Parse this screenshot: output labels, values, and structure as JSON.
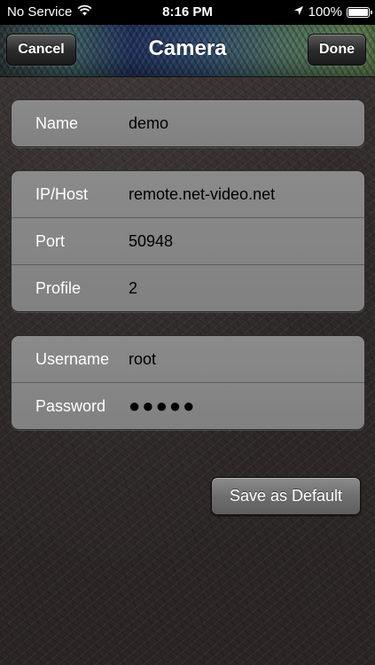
{
  "status_bar": {
    "carrier": "No Service",
    "time": "8:16 PM",
    "battery_percent": "100%",
    "battery_level": 1.0
  },
  "nav": {
    "title": "Camera",
    "cancel_label": "Cancel",
    "done_label": "Done"
  },
  "groups": {
    "name": {
      "label": "Name",
      "value": "demo"
    },
    "host": {
      "label": "IP/Host",
      "value": "remote.net-video.net"
    },
    "port": {
      "label": "Port",
      "value": "50948"
    },
    "profile": {
      "label": "Profile",
      "value": "2"
    },
    "username": {
      "label": "Username",
      "value": "root"
    },
    "password": {
      "label": "Password",
      "value": "●●●●●"
    }
  },
  "actions": {
    "save_default_label": "Save as Default"
  },
  "icons": {
    "wifi": "wifi-icon",
    "location": "location-arrow-icon",
    "battery": "battery-icon"
  }
}
